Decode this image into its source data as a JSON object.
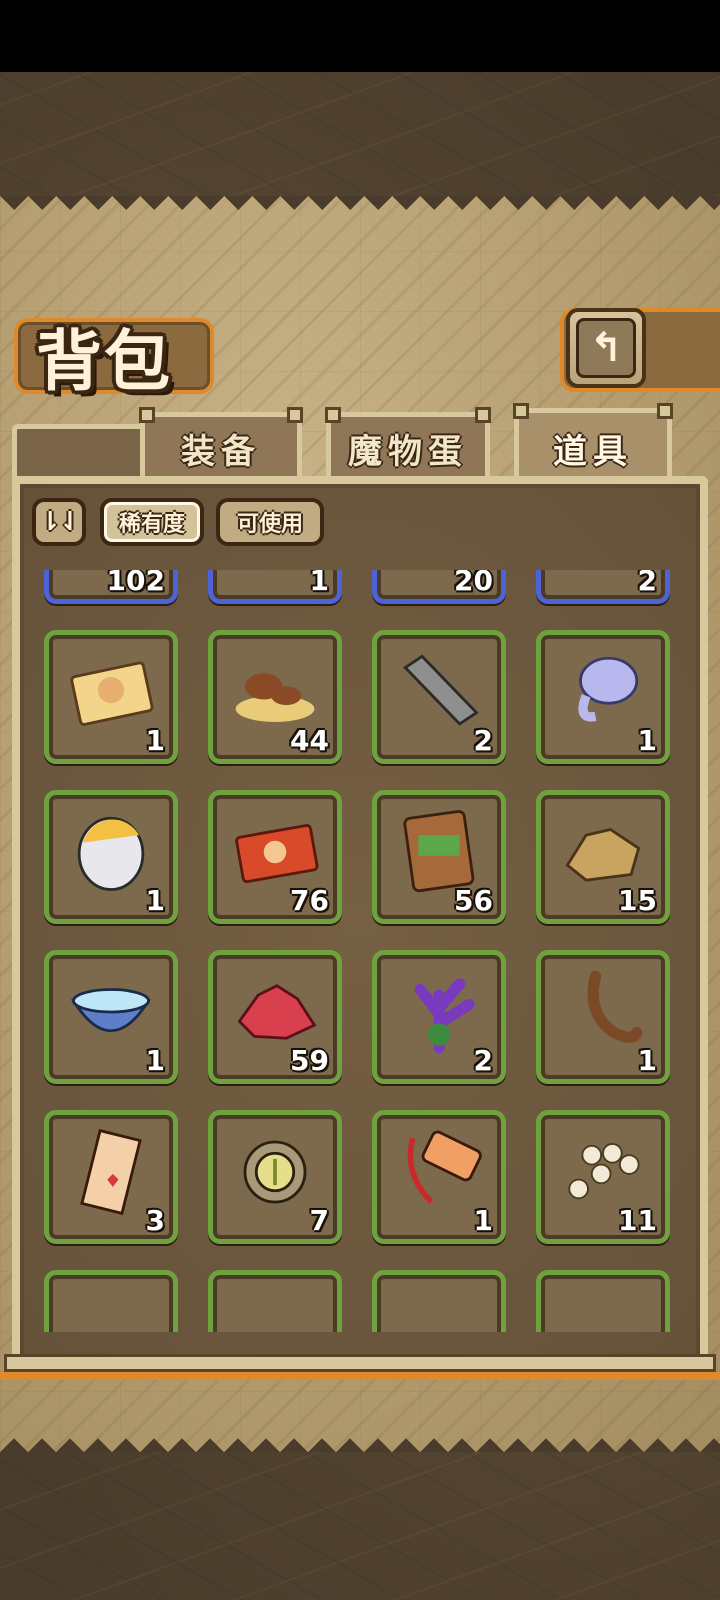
{
  "title": "背包",
  "back_button": {
    "label": "↰"
  },
  "tabs": [
    {
      "label": "装备",
      "active": false
    },
    {
      "label": "魔物蛋",
      "active": false
    },
    {
      "label": "道具",
      "active": true
    }
  ],
  "filters": {
    "sort_label": "⇂⇃",
    "rarity_label": "稀有度",
    "usable_label": "可使用"
  },
  "items": [
    {
      "icon": "purple-item-icon",
      "count": "102",
      "rarity": "blue"
    },
    {
      "icon": "pearls-icon",
      "count": "1",
      "rarity": "blue"
    },
    {
      "icon": "red-shard-icon",
      "count": "20",
      "rarity": "blue"
    },
    {
      "icon": "red-flower-icon",
      "count": "2",
      "rarity": "blue"
    },
    {
      "icon": "ticket-icon",
      "count": "1",
      "rarity": "green"
    },
    {
      "icon": "mushroom-icon",
      "count": "44",
      "rarity": "green"
    },
    {
      "icon": "iron-bar-icon",
      "count": "2",
      "rarity": "green"
    },
    {
      "icon": "ghost-slime-icon",
      "count": "1",
      "rarity": "green"
    },
    {
      "icon": "egg-capsule-icon",
      "count": "1",
      "rarity": "green"
    },
    {
      "icon": "red-ticket-icon",
      "count": "76",
      "rarity": "green"
    },
    {
      "icon": "snack-bag-icon",
      "count": "56",
      "rarity": "green"
    },
    {
      "icon": "gold-ore-icon",
      "count": "15",
      "rarity": "green"
    },
    {
      "icon": "water-bowl-icon",
      "count": "1",
      "rarity": "green"
    },
    {
      "icon": "red-crystal-icon",
      "count": "59",
      "rarity": "green"
    },
    {
      "icon": "purple-coral-icon",
      "count": "2",
      "rarity": "green"
    },
    {
      "icon": "root-icon",
      "count": "1",
      "rarity": "green"
    },
    {
      "icon": "talisman-icon",
      "count": "3",
      "rarity": "green"
    },
    {
      "icon": "turtle-medal-icon",
      "count": "7",
      "rarity": "green"
    },
    {
      "icon": "charm-tag-icon",
      "count": "1",
      "rarity": "green"
    },
    {
      "icon": "eggs-icon",
      "count": "11",
      "rarity": "green"
    },
    {
      "icon": "blue-item-icon",
      "count": "",
      "rarity": "green"
    },
    {
      "icon": "dark-item-icon",
      "count": "",
      "rarity": "green"
    },
    {
      "icon": "card-item-icon",
      "count": "",
      "rarity": "green"
    },
    {
      "icon": "dark-item-icon",
      "count": "",
      "rarity": "green"
    }
  ]
}
